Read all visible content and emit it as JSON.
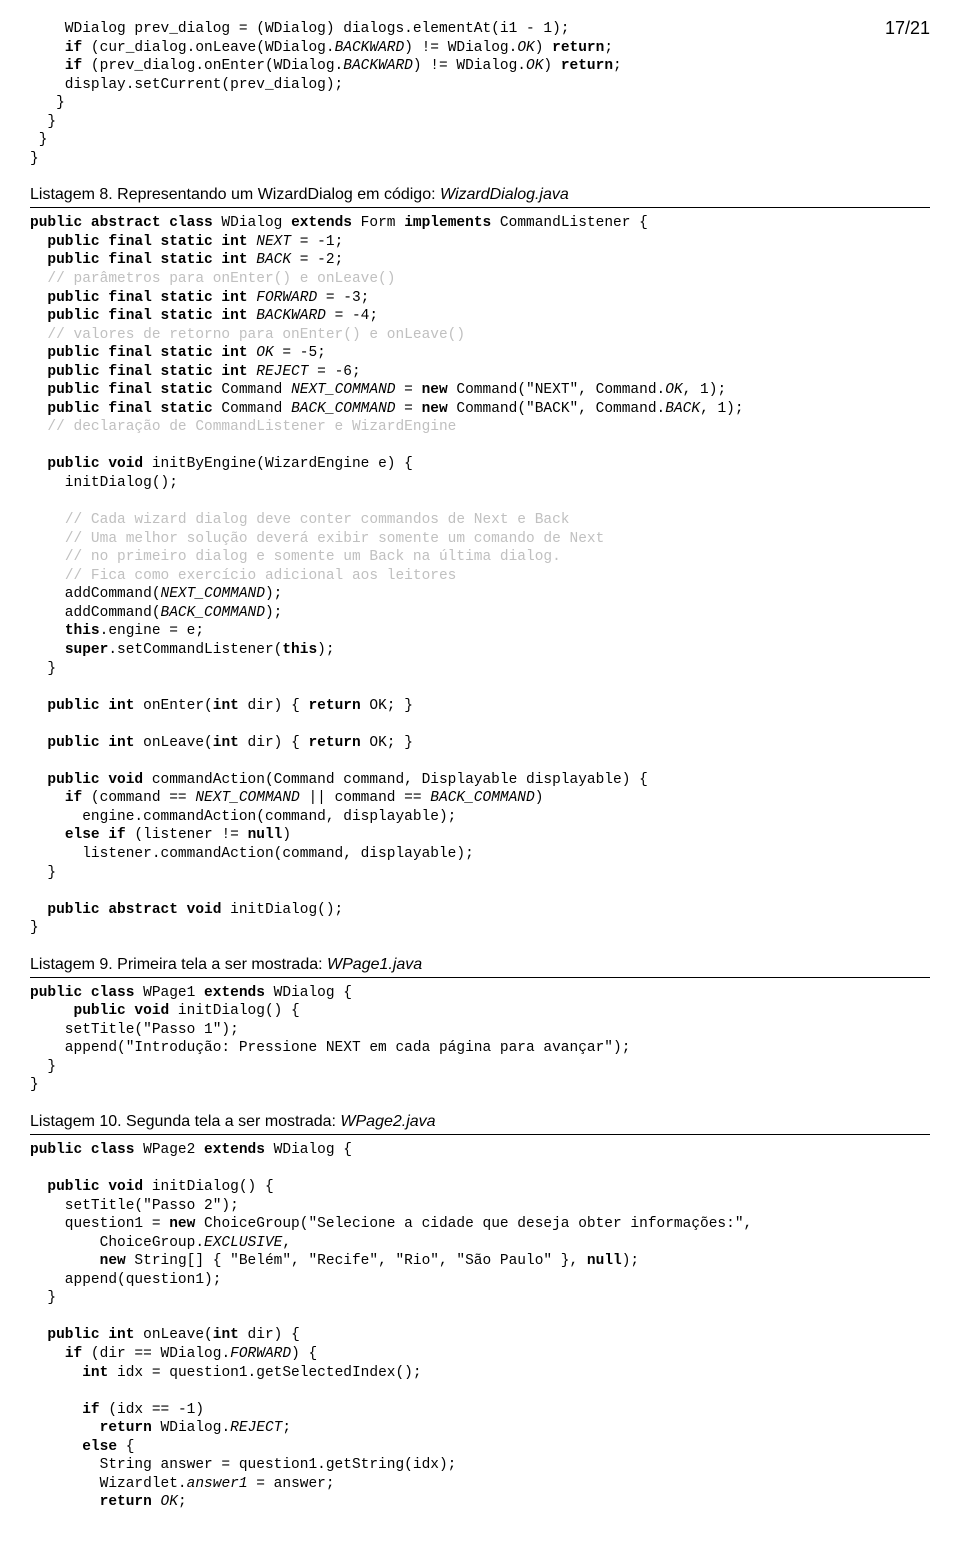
{
  "page_number": "17/21",
  "snippet_top_lines": [
    [
      {
        "t": "    WDialog prev_dialog = (WDialog) dialogs.elementAt(i1 - 1);"
      }
    ],
    [
      {
        "t": "    "
      },
      {
        "t": "if",
        "cls": "kw"
      },
      {
        "t": " (cur_dialog.onLeave(WDialog."
      },
      {
        "t": "BACKWARD",
        "cls": "it"
      },
      {
        "t": ") != WDialog."
      },
      {
        "t": "OK",
        "cls": "it"
      },
      {
        "t": ") "
      },
      {
        "t": "return",
        "cls": "kw"
      },
      {
        "t": ";"
      }
    ],
    [
      {
        "t": "    "
      },
      {
        "t": "if",
        "cls": "kw"
      },
      {
        "t": " (prev_dialog.onEnter(WDialog."
      },
      {
        "t": "BACKWARD",
        "cls": "it"
      },
      {
        "t": ") != WDialog."
      },
      {
        "t": "OK",
        "cls": "it"
      },
      {
        "t": ") "
      },
      {
        "t": "return",
        "cls": "kw"
      },
      {
        "t": ";"
      }
    ],
    [
      {
        "t": "    display.setCurrent(prev_dialog);"
      }
    ],
    [
      {
        "t": "   }"
      }
    ],
    [
      {
        "t": "  }"
      }
    ],
    [
      {
        "t": " }"
      }
    ],
    [
      {
        "t": "}"
      }
    ]
  ],
  "listing8": {
    "title_prefix": "Listagem 8. Representando um WizardDialog em código: ",
    "title_italic": "WizardDialog.java",
    "lines": [
      [
        {
          "t": "public abstract class",
          "cls": "kw"
        },
        {
          "t": " WDialog "
        },
        {
          "t": "extends",
          "cls": "kw"
        },
        {
          "t": " Form "
        },
        {
          "t": "implements",
          "cls": "kw"
        },
        {
          "t": " CommandListener {"
        }
      ],
      [
        {
          "t": "  "
        },
        {
          "t": "public final static int",
          "cls": "kw"
        },
        {
          "t": " "
        },
        {
          "t": "NEXT",
          "cls": "it"
        },
        {
          "t": " = -1;"
        }
      ],
      [
        {
          "t": "  "
        },
        {
          "t": "public final static int",
          "cls": "kw"
        },
        {
          "t": " "
        },
        {
          "t": "BACK",
          "cls": "it"
        },
        {
          "t": " = -2;"
        }
      ],
      [
        {
          "t": "  "
        },
        {
          "t": "// parâmetros para onEnter() e onLeave()",
          "cls": "cm"
        }
      ],
      [
        {
          "t": "  "
        },
        {
          "t": "public final static int",
          "cls": "kw"
        },
        {
          "t": " "
        },
        {
          "t": "FORWARD",
          "cls": "it"
        },
        {
          "t": " = -3;"
        }
      ],
      [
        {
          "t": "  "
        },
        {
          "t": "public final static int",
          "cls": "kw"
        },
        {
          "t": " "
        },
        {
          "t": "BACKWARD",
          "cls": "it"
        },
        {
          "t": " = -4;"
        }
      ],
      [
        {
          "t": "  "
        },
        {
          "t": "// valores de retorno para onEnter() e onLeave()",
          "cls": "cm"
        }
      ],
      [
        {
          "t": "  "
        },
        {
          "t": "public final static int",
          "cls": "kw"
        },
        {
          "t": " "
        },
        {
          "t": "OK",
          "cls": "it"
        },
        {
          "t": " = -5;"
        }
      ],
      [
        {
          "t": "  "
        },
        {
          "t": "public final static int",
          "cls": "kw"
        },
        {
          "t": " "
        },
        {
          "t": "REJECT",
          "cls": "it"
        },
        {
          "t": " = -6;"
        }
      ],
      [
        {
          "t": "  "
        },
        {
          "t": "public final static",
          "cls": "kw"
        },
        {
          "t": " Command "
        },
        {
          "t": "NEXT_COMMAND",
          "cls": "it"
        },
        {
          "t": " = "
        },
        {
          "t": "new",
          "cls": "kw"
        },
        {
          "t": " Command(\"NEXT\", Command."
        },
        {
          "t": "OK",
          "cls": "it"
        },
        {
          "t": ", 1);"
        }
      ],
      [
        {
          "t": "  "
        },
        {
          "t": "public final static",
          "cls": "kw"
        },
        {
          "t": " Command "
        },
        {
          "t": "BACK_COMMAND",
          "cls": "it"
        },
        {
          "t": " = "
        },
        {
          "t": "new",
          "cls": "kw"
        },
        {
          "t": " Command(\"BACK\", Command."
        },
        {
          "t": "BACK",
          "cls": "it"
        },
        {
          "t": ", 1);"
        }
      ],
      [
        {
          "t": "  "
        },
        {
          "t": "// declaração de CommandListener e WizardEngine",
          "cls": "cm"
        }
      ],
      [
        {
          "t": ""
        }
      ],
      [
        {
          "t": "  "
        },
        {
          "t": "public void",
          "cls": "kw"
        },
        {
          "t": " initByEngine(WizardEngine e) {"
        }
      ],
      [
        {
          "t": "    initDialog();"
        }
      ],
      [
        {
          "t": ""
        }
      ],
      [
        {
          "t": "    "
        },
        {
          "t": "// Cada wizard dialog deve conter commandos de Next e Back",
          "cls": "cm"
        }
      ],
      [
        {
          "t": "    "
        },
        {
          "t": "// Uma melhor solução deverá exibir somente um comando de Next",
          "cls": "cm"
        }
      ],
      [
        {
          "t": "    "
        },
        {
          "t": "// no primeiro dialog e somente um Back na última dialog.",
          "cls": "cm"
        }
      ],
      [
        {
          "t": "    "
        },
        {
          "t": "// Fica como exercício adicional aos leitores",
          "cls": "cm"
        }
      ],
      [
        {
          "t": "    addCommand("
        },
        {
          "t": "NEXT_COMMAND",
          "cls": "it"
        },
        {
          "t": ");"
        }
      ],
      [
        {
          "t": "    addCommand("
        },
        {
          "t": "BACK_COMMAND",
          "cls": "it"
        },
        {
          "t": ");"
        }
      ],
      [
        {
          "t": "    "
        },
        {
          "t": "this",
          "cls": "kw"
        },
        {
          "t": ".engine = e;"
        }
      ],
      [
        {
          "t": "    "
        },
        {
          "t": "super",
          "cls": "kw"
        },
        {
          "t": ".setCommandListener("
        },
        {
          "t": "this",
          "cls": "kw"
        },
        {
          "t": ");"
        }
      ],
      [
        {
          "t": "  }"
        }
      ],
      [
        {
          "t": ""
        }
      ],
      [
        {
          "t": "  "
        },
        {
          "t": "public int",
          "cls": "kw"
        },
        {
          "t": " onEnter("
        },
        {
          "t": "int",
          "cls": "kw"
        },
        {
          "t": " dir) { "
        },
        {
          "t": "return",
          "cls": "kw"
        },
        {
          "t": " OK; }"
        }
      ],
      [
        {
          "t": ""
        }
      ],
      [
        {
          "t": "  "
        },
        {
          "t": "public int",
          "cls": "kw"
        },
        {
          "t": " onLeave("
        },
        {
          "t": "int",
          "cls": "kw"
        },
        {
          "t": " dir) { "
        },
        {
          "t": "return",
          "cls": "kw"
        },
        {
          "t": " OK; }"
        }
      ],
      [
        {
          "t": ""
        }
      ],
      [
        {
          "t": "  "
        },
        {
          "t": "public void",
          "cls": "kw"
        },
        {
          "t": " commandAction(Command command, Displayable displayable) {"
        }
      ],
      [
        {
          "t": "    "
        },
        {
          "t": "if",
          "cls": "kw"
        },
        {
          "t": " (command == "
        },
        {
          "t": "NEXT_COMMAND",
          "cls": "it"
        },
        {
          "t": " || command == "
        },
        {
          "t": "BACK_COMMAND",
          "cls": "it"
        },
        {
          "t": ")"
        }
      ],
      [
        {
          "t": "      engine.commandAction(command, displayable);"
        }
      ],
      [
        {
          "t": "    "
        },
        {
          "t": "else if",
          "cls": "kw"
        },
        {
          "t": " (listener != "
        },
        {
          "t": "null",
          "cls": "kw"
        },
        {
          "t": ")"
        }
      ],
      [
        {
          "t": "      listener.commandAction(command, displayable);"
        }
      ],
      [
        {
          "t": "  }"
        }
      ],
      [
        {
          "t": ""
        }
      ],
      [
        {
          "t": "  "
        },
        {
          "t": "public abstract void",
          "cls": "kw"
        },
        {
          "t": " initDialog();"
        }
      ],
      [
        {
          "t": "}"
        }
      ]
    ]
  },
  "listing9": {
    "title_prefix": "Listagem 9. Primeira tela a ser mostrada: ",
    "title_italic": "WPage1.java",
    "lines": [
      [
        {
          "t": "public class",
          "cls": "kw"
        },
        {
          "t": " WPage1 "
        },
        {
          "t": "extends",
          "cls": "kw"
        },
        {
          "t": " WDialog {"
        }
      ],
      [
        {
          "t": "     "
        },
        {
          "t": "public void",
          "cls": "kw"
        },
        {
          "t": " initDialog() {"
        }
      ],
      [
        {
          "t": "    setTitle(\"Passo 1\");"
        }
      ],
      [
        {
          "t": "    append(\"Introdução: Pressione NEXT em cada página para avançar\");"
        }
      ],
      [
        {
          "t": "  }"
        }
      ],
      [
        {
          "t": "}"
        }
      ]
    ]
  },
  "listing10": {
    "title_prefix": "Listagem 10. Segunda tela a ser mostrada: ",
    "title_italic": "WPage2.java",
    "lines": [
      [
        {
          "t": "public class",
          "cls": "kw"
        },
        {
          "t": " WPage2 "
        },
        {
          "t": "extends",
          "cls": "kw"
        },
        {
          "t": " WDialog {"
        }
      ],
      [
        {
          "t": ""
        }
      ],
      [
        {
          "t": "  "
        },
        {
          "t": "public void",
          "cls": "kw"
        },
        {
          "t": " initDialog() {"
        }
      ],
      [
        {
          "t": "    setTitle(\"Passo 2\");"
        }
      ],
      [
        {
          "t": "    question1 = "
        },
        {
          "t": "new",
          "cls": "kw"
        },
        {
          "t": " ChoiceGroup(\"Selecione a cidade que deseja obter informações:\","
        }
      ],
      [
        {
          "t": "        ChoiceGroup."
        },
        {
          "t": "EXCLUSIVE",
          "cls": "it"
        },
        {
          "t": ","
        }
      ],
      [
        {
          "t": "        "
        },
        {
          "t": "new",
          "cls": "kw"
        },
        {
          "t": " String[] { \"Belém\", \"Recife\", \"Rio\", \"São Paulo\" }, "
        },
        {
          "t": "null",
          "cls": "kw"
        },
        {
          "t": ");"
        }
      ],
      [
        {
          "t": "    append(question1);"
        }
      ],
      [
        {
          "t": "  }"
        }
      ],
      [
        {
          "t": ""
        }
      ],
      [
        {
          "t": "  "
        },
        {
          "t": "public int",
          "cls": "kw"
        },
        {
          "t": " onLeave("
        },
        {
          "t": "int",
          "cls": "kw"
        },
        {
          "t": " dir) {"
        }
      ],
      [
        {
          "t": "    "
        },
        {
          "t": "if",
          "cls": "kw"
        },
        {
          "t": " (dir == WDialog."
        },
        {
          "t": "FORWARD",
          "cls": "it"
        },
        {
          "t": ") {"
        }
      ],
      [
        {
          "t": "      "
        },
        {
          "t": "int",
          "cls": "kw"
        },
        {
          "t": " idx = question1.getSelectedIndex();"
        }
      ],
      [
        {
          "t": ""
        }
      ],
      [
        {
          "t": "      "
        },
        {
          "t": "if",
          "cls": "kw"
        },
        {
          "t": " (idx == -1)"
        }
      ],
      [
        {
          "t": "        "
        },
        {
          "t": "return",
          "cls": "kw"
        },
        {
          "t": " WDialog."
        },
        {
          "t": "REJECT",
          "cls": "it"
        },
        {
          "t": ";"
        }
      ],
      [
        {
          "t": "      "
        },
        {
          "t": "else",
          "cls": "kw"
        },
        {
          "t": " {"
        }
      ],
      [
        {
          "t": "        String answer = question1.getString(idx);"
        }
      ],
      [
        {
          "t": "        Wizardlet."
        },
        {
          "t": "answer1",
          "cls": "it"
        },
        {
          "t": " = answer;"
        }
      ],
      [
        {
          "t": "        "
        },
        {
          "t": "return",
          "cls": "kw"
        },
        {
          "t": " "
        },
        {
          "t": "OK",
          "cls": "it"
        },
        {
          "t": ";"
        }
      ]
    ]
  }
}
